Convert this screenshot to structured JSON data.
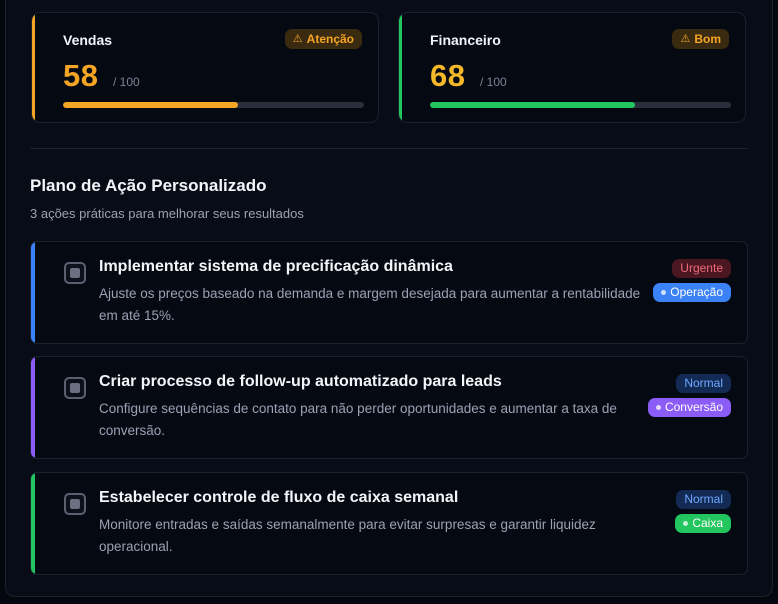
{
  "score_cards": [
    {
      "title": "Vendas",
      "badge": "Atenção",
      "badge_icon": "warning-icon",
      "score": "58",
      "out_of": "/ 100",
      "progress": 0.58,
      "accent_color": "#f5a524",
      "badge_bg": "#3a2a10",
      "badge_color": "#f5a524"
    },
    {
      "title": "Financeiro",
      "badge": "Bom",
      "badge_icon": "warning-icon",
      "score": "68",
      "out_of": "/ 100",
      "progress": 0.68,
      "accent_color": "#22c55e",
      "score_color": "#f5b829",
      "badge_bg": "#3a2a10",
      "badge_color": "#f5a524"
    }
  ],
  "plan": {
    "title": "Plano de Ação Personalizado",
    "subtitle": "3 ações práticas para melhorar seus resultados"
  },
  "actions": [
    {
      "title": "Implementar sistema de precificação dinâmica",
      "description": "Ajuste os preços baseado na demanda e margem desejada para aumentar a rentabilidade em até 15%.",
      "priority": "Urgente",
      "category": "Operação",
      "accent_color": "#3b82f6",
      "priority_bg": "#4a1620",
      "priority_color": "#f06a7a",
      "category_bg": "#3b82f6"
    },
    {
      "title": "Criar processo de follow-up automatizado para leads",
      "description": "Configure sequências de contato para não perder oportunidades e aumentar a taxa de conversão.",
      "priority": "Normal",
      "category": "Conversão",
      "accent_color": "#8b5cf6",
      "priority_bg": "#132a55",
      "priority_color": "#6ea8ff",
      "category_bg": "#8b5cf6"
    },
    {
      "title": "Estabelecer controle de fluxo de caixa semanal",
      "description": "Monitore entradas e saídas semanalmente para evitar surpresas e garantir liquidez operacional.",
      "priority": "Normal",
      "category": "Caixa",
      "accent_color": "#22c55e",
      "priority_bg": "#132a55",
      "priority_color": "#6ea8ff",
      "category_bg": "#22c55e"
    }
  ]
}
